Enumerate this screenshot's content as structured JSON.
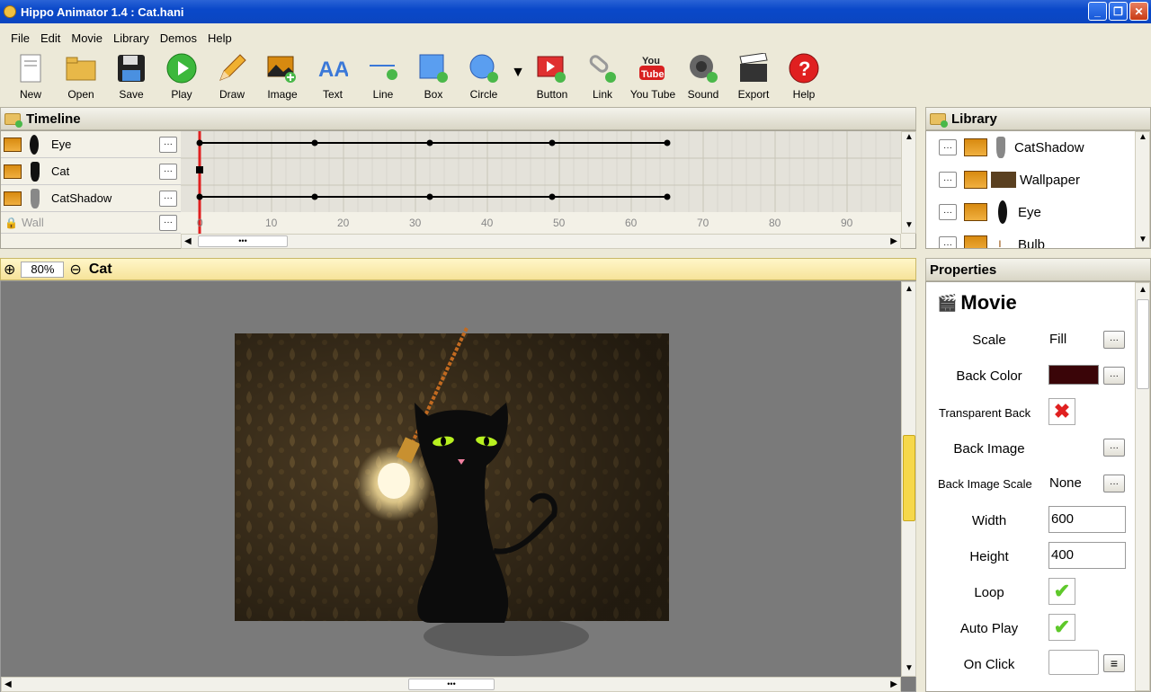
{
  "window": {
    "title": "Hippo Animator 1.4 : Cat.hani"
  },
  "menu": [
    "File",
    "Edit",
    "Movie",
    "Library",
    "Demos",
    "Help"
  ],
  "toolbar": [
    {
      "label": "New",
      "icon": "new-file-icon"
    },
    {
      "label": "Open",
      "icon": "folder-open-icon"
    },
    {
      "label": "Save",
      "icon": "save-disk-icon"
    },
    {
      "label": "Play",
      "icon": "play-icon"
    },
    {
      "label": "Draw",
      "icon": "pencil-icon"
    },
    {
      "label": "Image",
      "icon": "image-icon"
    },
    {
      "label": "Text",
      "icon": "text-icon"
    },
    {
      "label": "Line",
      "icon": "line-icon"
    },
    {
      "label": "Box",
      "icon": "box-icon"
    },
    {
      "label": "Circle",
      "icon": "circle-icon"
    },
    {
      "label": "Button",
      "icon": "button-icon"
    },
    {
      "label": "Link",
      "icon": "link-icon"
    },
    {
      "label": "You Tube",
      "icon": "youtube-icon"
    },
    {
      "label": "Sound",
      "icon": "sound-icon"
    },
    {
      "label": "Export",
      "icon": "clapper-icon"
    },
    {
      "label": "Help",
      "icon": "help-icon"
    }
  ],
  "timeline": {
    "title": "Timeline",
    "layers": [
      {
        "name": "Eye"
      },
      {
        "name": "Cat"
      },
      {
        "name": "CatShadow"
      },
      {
        "name": "Wall"
      }
    ],
    "ruler": [
      "0",
      "10",
      "20",
      "30",
      "40",
      "50",
      "60",
      "70",
      "80",
      "90"
    ]
  },
  "library": {
    "title": "Library",
    "items": [
      {
        "name": "CatShadow"
      },
      {
        "name": "Wallpaper"
      },
      {
        "name": "Eye"
      },
      {
        "name": "Bulb"
      }
    ]
  },
  "stage": {
    "zoom": "80%",
    "title": "Cat"
  },
  "properties": {
    "title": "Properties",
    "section": "Movie",
    "scale_label": "Scale",
    "scale_value": "Fill",
    "backcolor_label": "Back Color",
    "backcolor_value": "#3a0508",
    "transparent_label": "Transparent Back",
    "backimage_label": "Back Image",
    "backimagescale_label": "Back Image Scale",
    "backimagescale_value": "None",
    "width_label": "Width",
    "width_value": "600",
    "height_label": "Height",
    "height_value": "400",
    "loop_label": "Loop",
    "autoplay_label": "Auto Play",
    "onclick_label": "On Click"
  }
}
